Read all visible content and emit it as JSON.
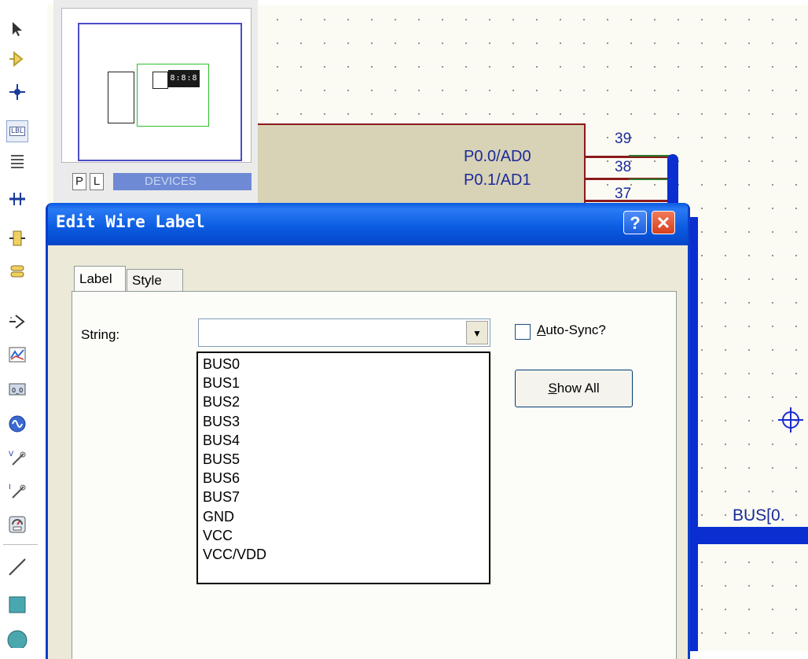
{
  "overview": {
    "pl_buttons": [
      "P",
      "L"
    ],
    "devices_label": "DEVICES",
    "preview_display": "8:8:8"
  },
  "toolbar": {
    "icons": [
      "selection-arrow-icon",
      "component-icon",
      "junction-dot-icon",
      "wire-label-icon",
      "text-script-icon",
      "bus-icon",
      "subcircuit-icon",
      "terminals-icon",
      "device-pins-icon",
      "graph-icon",
      "tape-recorder-icon",
      "generator-icon",
      "voltage-probe-icon",
      "current-probe-icon",
      "virtual-instruments-icon",
      "line-icon",
      "box-icon",
      "circle-icon"
    ],
    "wire_label_text": "LBL"
  },
  "schematic": {
    "pins": [
      {
        "label": "P0.0/AD0",
        "number": "39"
      },
      {
        "label": "P0.1/AD1",
        "number": "38"
      },
      {
        "label": "",
        "number": "37"
      }
    ],
    "bus_label": "BUS[0."
  },
  "dialog": {
    "title": "Edit Wire Label",
    "help_label": "?",
    "close_label": "✕",
    "tabs": [
      {
        "label": "Label",
        "active": true
      },
      {
        "label": "Style",
        "active": false
      }
    ],
    "string_label": "String:",
    "string_value": "",
    "string_options": [
      "BUS0",
      "BUS1",
      "BUS2",
      "BUS3",
      "BUS4",
      "BUS5",
      "BUS6",
      "BUS7",
      "GND",
      "VCC",
      "VCC/VDD"
    ],
    "auto_sync": {
      "label_prefix": "",
      "label_accel": "A",
      "label_rest": "uto-Sync?",
      "checked": false
    },
    "show_all": {
      "label_accel": "S",
      "label_rest": "how All"
    }
  },
  "colors": {
    "titlebar": "#0a5ae0",
    "bus": "#0a2ed0",
    "chip_fill": "#d8d2b6",
    "chip_outline": "#8b1a1a",
    "pin_text": "#1a2a9a"
  }
}
